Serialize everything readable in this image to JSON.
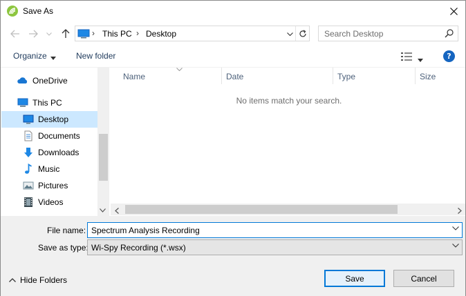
{
  "window": {
    "title": "Save As",
    "close_glyph": "✕"
  },
  "nav": {
    "back_icon": "arrow-left-icon",
    "forward_icon": "arrow-right-icon",
    "recent_icon": "chevron-down-icon",
    "up_icon": "arrow-up-icon"
  },
  "address": {
    "crumbs": [
      "This PC",
      "Desktop"
    ],
    "separator": "›"
  },
  "search": {
    "placeholder": "Search Desktop"
  },
  "toolbar": {
    "organize_label": "Organize",
    "new_folder_label": "New folder",
    "help_label": "?"
  },
  "sidebar": {
    "items": [
      {
        "label": "OneDrive",
        "icon": "cloud-icon"
      },
      {
        "label": "This PC",
        "icon": "computer-icon"
      },
      {
        "label": "Desktop",
        "icon": "desktop-icon",
        "selected": true
      },
      {
        "label": "Documents",
        "icon": "documents-icon"
      },
      {
        "label": "Downloads",
        "icon": "download-icon"
      },
      {
        "label": "Music",
        "icon": "music-icon"
      },
      {
        "label": "Pictures",
        "icon": "pictures-icon"
      },
      {
        "label": "Videos",
        "icon": "videos-icon"
      }
    ]
  },
  "files": {
    "columns": [
      "Name",
      "Date",
      "Type",
      "Size"
    ],
    "empty_message": "No items match your search."
  },
  "form": {
    "file_name_label": "File name:",
    "file_name_value": "Spectrum Analysis Recording",
    "save_type_label": "Save as type:",
    "save_type_value": "Wi-Spy Recording (*.wsx)"
  },
  "footer": {
    "hide_folders_label": "Hide Folders",
    "save_label": "Save",
    "cancel_label": "Cancel"
  },
  "colors": {
    "accent": "#0078d7",
    "selection": "#cce8ff",
    "app_icon": "#8dc63f",
    "help": "#1565c0"
  }
}
